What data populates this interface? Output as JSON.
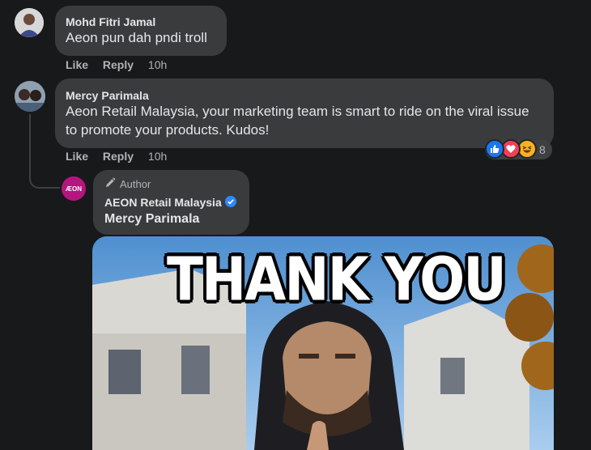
{
  "comments": [
    {
      "author": "Mohd Fitri Jamal",
      "text": "Aeon pun dah pndi troll",
      "like_label": "Like",
      "reply_label": "Reply",
      "time": "10h"
    },
    {
      "author": "Mercy Parimala",
      "text_line1": "Aeon Retail Malaysia, your marketing team is smart to ride on the viral issue",
      "text_line2": "to promote your products. Kudos!",
      "like_label": "Like",
      "reply_label": "Reply",
      "time": "10h",
      "reactions": [
        "like-icon",
        "love-icon",
        "haha-icon"
      ],
      "reaction_count": "8"
    }
  ],
  "reply": {
    "badge": "Author",
    "author": "AEON Retail Malaysia",
    "verified": true,
    "mention": "Mercy Parimala",
    "avatar_text": "ÆON",
    "gif_caption": "THANK YOU"
  },
  "colors": {
    "background": "#18191a",
    "bubble": "#3a3b3c",
    "aeon_brand": "#b5157f",
    "verified": "#2d88ff",
    "like": "#1877f2",
    "love": "#f33e58",
    "haha": "#f7b125"
  }
}
